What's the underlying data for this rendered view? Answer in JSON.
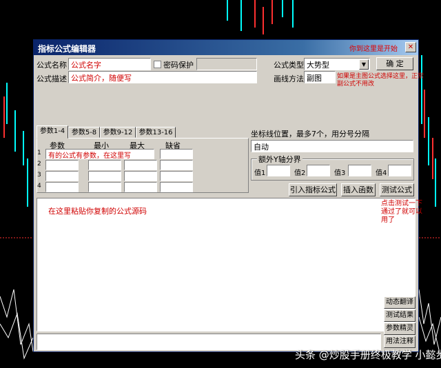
{
  "window": {
    "title": "指标公式编辑器",
    "title_note": "你到这里是开始",
    "close_glyph": "✕"
  },
  "fields": {
    "name_label": "公式名称",
    "name_value": "公式名字",
    "password_label": "密码保护",
    "desc_label": "公式描述",
    "desc_value": "公式简介，随便写",
    "type_label": "公式类型",
    "type_value": "大势型",
    "draw_label": "画线方法",
    "draw_value": "副图"
  },
  "buttons": {
    "ok": "确 定",
    "import": "引入指标公式",
    "insert_func": "插入函数",
    "test": "测试公式"
  },
  "notes": {
    "draw_note_1": "如果是主图公式选择这里，正常",
    "draw_note_2": "副公式不用改",
    "test_note_1": "点击测试一下",
    "test_note_2": "通过了就可以",
    "test_note_3": "用了",
    "editor_hint": "在这里粘贴你复制的公式源码"
  },
  "tabs": [
    {
      "label": "参数1-4"
    },
    {
      "label": "参数5-8"
    },
    {
      "label": "参数9-12"
    },
    {
      "label": "参数13-16"
    }
  ],
  "param_table": {
    "headers": [
      "参数",
      "最小",
      "最大",
      "缺省"
    ],
    "row_numbers": [
      "1",
      "2",
      "3",
      "4"
    ],
    "row1_hint": "有的公式有参数，在这里写"
  },
  "axis": {
    "label": "坐标线位置，最多7个，用分号分隔",
    "value": "自动",
    "group_title": "额外Y轴分界",
    "v1": "值1",
    "v2": "值2",
    "v3": "值3",
    "v4": "值4"
  },
  "side_buttons": {
    "translate": "动态翻译",
    "result": "测试结果",
    "param_help": "参数精灵",
    "usage": "用法注释"
  },
  "watermark": "头条 @炒股手册终极教学 小懿步迹",
  "icons": {
    "dropdown": "chevron-down-icon",
    "close": "close-icon"
  },
  "colors": {
    "title_bar": "#0a246a",
    "note_red": "#d00000",
    "dialog_bg": "#d4d0c8"
  }
}
